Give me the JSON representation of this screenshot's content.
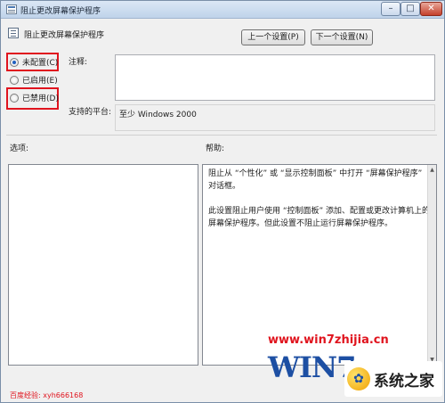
{
  "window": {
    "title": "阻止更改屏幕保护程序",
    "minimize_glyph": "–",
    "maximize_glyph": "□",
    "close_glyph": "✕"
  },
  "header": {
    "policy_name": "阻止更改屏幕保护程序",
    "prev_button": "上一个设置(P)",
    "next_button": "下一个设置(N)"
  },
  "options": {
    "not_configured": "未配置(C)",
    "enabled": "已启用(E)",
    "disabled": "已禁用(D)",
    "selected": "not_configured"
  },
  "comment": {
    "label": "注释:",
    "value": ""
  },
  "platform": {
    "label": "支持的平台:",
    "value": "至少 Windows 2000"
  },
  "sections": {
    "options_label": "选项:",
    "help_label": "帮助:"
  },
  "help": {
    "para1": "阻止从 “个性化” 或 “显示控制面板” 中打开 “屏幕保护程序” 对话框。",
    "para2": "此设置阻止用户使用 “控制面板” 添加、配置或更改计算机上的屏幕保护程序。但此设置不阻止运行屏幕保护程序。"
  },
  "scrollbar": {
    "up_glyph": "▲",
    "down_glyph": "▼"
  },
  "watermark": {
    "url": "www.win7zhijia.cn",
    "logo": "WIN7",
    "site": "系统之家",
    "badge_glyph": "✿",
    "baidu": "百度经验: xyh666168"
  },
  "colors": {
    "highlight": "#e0141e",
    "radio_dot": "#1f5fbf",
    "watermark_logo": "#1d4fa3"
  }
}
